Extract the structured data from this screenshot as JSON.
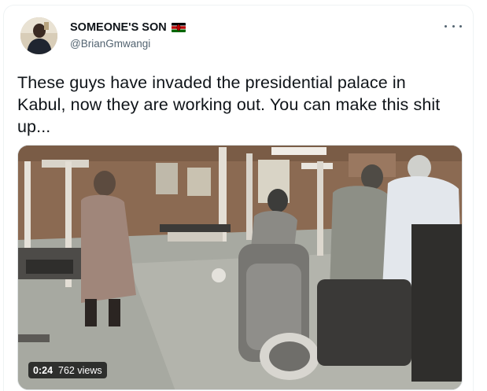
{
  "tweet": {
    "author": {
      "display_name": "SOMEONE'S SON",
      "flag_icon": "kenya-flag-icon",
      "handle": "@BrianGmwangi",
      "avatar_icon": "profile-avatar"
    },
    "more_icon": "more-options-icon",
    "text": "These guys have invaded the presidential palace in Kabul, now they are working out. You can make this shit up...",
    "media": {
      "type": "video",
      "duration": "0:24",
      "views": "762 views"
    }
  },
  "colors": {
    "text_primary": "#0f1419",
    "text_secondary": "#536471",
    "border": "#eff3f4",
    "badge_bg": "rgba(0,0,0,0.72)"
  }
}
